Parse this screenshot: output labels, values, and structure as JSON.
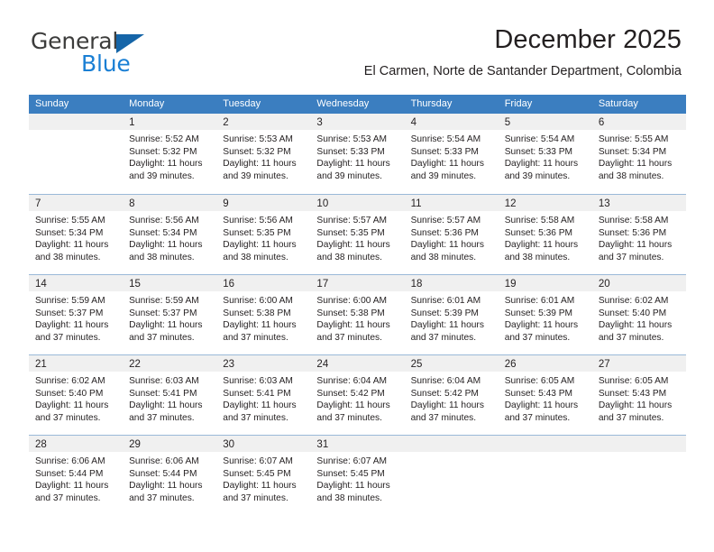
{
  "brand": {
    "name_top": "General",
    "name_bottom": "Blue",
    "accent_color": "#1a7fd4",
    "triangle_color": "#1565a8",
    "top_color": "#3c3c3b"
  },
  "header": {
    "title": "December 2025",
    "subtitle": "El Carmen, Norte de Santander Department, Colombia"
  },
  "theme": {
    "header_blue": "#3b7ec0",
    "band_gray": "#f0f0f0",
    "separator": "#9ab9d8",
    "text": "#231f20"
  },
  "weekdays": [
    "Sunday",
    "Monday",
    "Tuesday",
    "Wednesday",
    "Thursday",
    "Friday",
    "Saturday"
  ],
  "weeks": [
    [
      {
        "day": "",
        "lines": []
      },
      {
        "day": "1",
        "lines": [
          "Sunrise: 5:52 AM",
          "Sunset: 5:32 PM",
          "Daylight: 11 hours",
          "and 39 minutes."
        ]
      },
      {
        "day": "2",
        "lines": [
          "Sunrise: 5:53 AM",
          "Sunset: 5:32 PM",
          "Daylight: 11 hours",
          "and 39 minutes."
        ]
      },
      {
        "day": "3",
        "lines": [
          "Sunrise: 5:53 AM",
          "Sunset: 5:33 PM",
          "Daylight: 11 hours",
          "and 39 minutes."
        ]
      },
      {
        "day": "4",
        "lines": [
          "Sunrise: 5:54 AM",
          "Sunset: 5:33 PM",
          "Daylight: 11 hours",
          "and 39 minutes."
        ]
      },
      {
        "day": "5",
        "lines": [
          "Sunrise: 5:54 AM",
          "Sunset: 5:33 PM",
          "Daylight: 11 hours",
          "and 39 minutes."
        ]
      },
      {
        "day": "6",
        "lines": [
          "Sunrise: 5:55 AM",
          "Sunset: 5:34 PM",
          "Daylight: 11 hours",
          "and 38 minutes."
        ]
      }
    ],
    [
      {
        "day": "7",
        "lines": [
          "Sunrise: 5:55 AM",
          "Sunset: 5:34 PM",
          "Daylight: 11 hours",
          "and 38 minutes."
        ]
      },
      {
        "day": "8",
        "lines": [
          "Sunrise: 5:56 AM",
          "Sunset: 5:34 PM",
          "Daylight: 11 hours",
          "and 38 minutes."
        ]
      },
      {
        "day": "9",
        "lines": [
          "Sunrise: 5:56 AM",
          "Sunset: 5:35 PM",
          "Daylight: 11 hours",
          "and 38 minutes."
        ]
      },
      {
        "day": "10",
        "lines": [
          "Sunrise: 5:57 AM",
          "Sunset: 5:35 PM",
          "Daylight: 11 hours",
          "and 38 minutes."
        ]
      },
      {
        "day": "11",
        "lines": [
          "Sunrise: 5:57 AM",
          "Sunset: 5:36 PM",
          "Daylight: 11 hours",
          "and 38 minutes."
        ]
      },
      {
        "day": "12",
        "lines": [
          "Sunrise: 5:58 AM",
          "Sunset: 5:36 PM",
          "Daylight: 11 hours",
          "and 38 minutes."
        ]
      },
      {
        "day": "13",
        "lines": [
          "Sunrise: 5:58 AM",
          "Sunset: 5:36 PM",
          "Daylight: 11 hours",
          "and 37 minutes."
        ]
      }
    ],
    [
      {
        "day": "14",
        "lines": [
          "Sunrise: 5:59 AM",
          "Sunset: 5:37 PM",
          "Daylight: 11 hours",
          "and 37 minutes."
        ]
      },
      {
        "day": "15",
        "lines": [
          "Sunrise: 5:59 AM",
          "Sunset: 5:37 PM",
          "Daylight: 11 hours",
          "and 37 minutes."
        ]
      },
      {
        "day": "16",
        "lines": [
          "Sunrise: 6:00 AM",
          "Sunset: 5:38 PM",
          "Daylight: 11 hours",
          "and 37 minutes."
        ]
      },
      {
        "day": "17",
        "lines": [
          "Sunrise: 6:00 AM",
          "Sunset: 5:38 PM",
          "Daylight: 11 hours",
          "and 37 minutes."
        ]
      },
      {
        "day": "18",
        "lines": [
          "Sunrise: 6:01 AM",
          "Sunset: 5:39 PM",
          "Daylight: 11 hours",
          "and 37 minutes."
        ]
      },
      {
        "day": "19",
        "lines": [
          "Sunrise: 6:01 AM",
          "Sunset: 5:39 PM",
          "Daylight: 11 hours",
          "and 37 minutes."
        ]
      },
      {
        "day": "20",
        "lines": [
          "Sunrise: 6:02 AM",
          "Sunset: 5:40 PM",
          "Daylight: 11 hours",
          "and 37 minutes."
        ]
      }
    ],
    [
      {
        "day": "21",
        "lines": [
          "Sunrise: 6:02 AM",
          "Sunset: 5:40 PM",
          "Daylight: 11 hours",
          "and 37 minutes."
        ]
      },
      {
        "day": "22",
        "lines": [
          "Sunrise: 6:03 AM",
          "Sunset: 5:41 PM",
          "Daylight: 11 hours",
          "and 37 minutes."
        ]
      },
      {
        "day": "23",
        "lines": [
          "Sunrise: 6:03 AM",
          "Sunset: 5:41 PM",
          "Daylight: 11 hours",
          "and 37 minutes."
        ]
      },
      {
        "day": "24",
        "lines": [
          "Sunrise: 6:04 AM",
          "Sunset: 5:42 PM",
          "Daylight: 11 hours",
          "and 37 minutes."
        ]
      },
      {
        "day": "25",
        "lines": [
          "Sunrise: 6:04 AM",
          "Sunset: 5:42 PM",
          "Daylight: 11 hours",
          "and 37 minutes."
        ]
      },
      {
        "day": "26",
        "lines": [
          "Sunrise: 6:05 AM",
          "Sunset: 5:43 PM",
          "Daylight: 11 hours",
          "and 37 minutes."
        ]
      },
      {
        "day": "27",
        "lines": [
          "Sunrise: 6:05 AM",
          "Sunset: 5:43 PM",
          "Daylight: 11 hours",
          "and 37 minutes."
        ]
      }
    ],
    [
      {
        "day": "28",
        "lines": [
          "Sunrise: 6:06 AM",
          "Sunset: 5:44 PM",
          "Daylight: 11 hours",
          "and 37 minutes."
        ]
      },
      {
        "day": "29",
        "lines": [
          "Sunrise: 6:06 AM",
          "Sunset: 5:44 PM",
          "Daylight: 11 hours",
          "and 37 minutes."
        ]
      },
      {
        "day": "30",
        "lines": [
          "Sunrise: 6:07 AM",
          "Sunset: 5:45 PM",
          "Daylight: 11 hours",
          "and 37 minutes."
        ]
      },
      {
        "day": "31",
        "lines": [
          "Sunrise: 6:07 AM",
          "Sunset: 5:45 PM",
          "Daylight: 11 hours",
          "and 38 minutes."
        ]
      },
      {
        "day": "",
        "lines": []
      },
      {
        "day": "",
        "lines": []
      },
      {
        "day": "",
        "lines": []
      }
    ]
  ]
}
